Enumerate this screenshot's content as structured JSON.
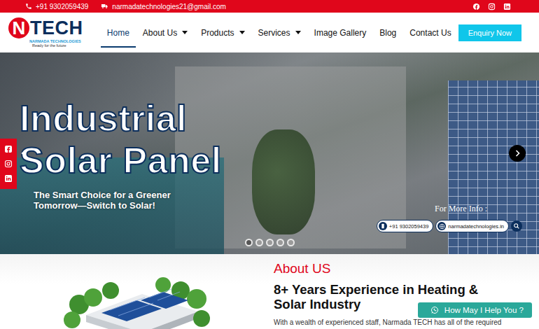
{
  "topbar": {
    "phone": "+91 9302059439",
    "email": "narmadatechnologies21@gmail.com"
  },
  "logo": {
    "letter": "N",
    "word": "TECH",
    "company": "NARMADA TECHNOLOGIES",
    "tagline": "Ready for the future"
  },
  "nav": {
    "items": [
      {
        "label": "Home",
        "selected": true,
        "dropdown": false
      },
      {
        "label": "About Us",
        "selected": false,
        "dropdown": true
      },
      {
        "label": "Products",
        "selected": false,
        "dropdown": true
      },
      {
        "label": "Services",
        "selected": false,
        "dropdown": true
      },
      {
        "label": "Image Gallery",
        "selected": false,
        "dropdown": false
      },
      {
        "label": "Blog",
        "selected": false,
        "dropdown": false
      },
      {
        "label": "Contact Us",
        "selected": false,
        "dropdown": false
      }
    ],
    "button": "Enquiry Now"
  },
  "hero": {
    "title_lines": [
      "Industrial",
      "Solar Panel"
    ],
    "subtitle_lines": [
      "The Smart Choice for a Greener",
      "Tomorrow—Switch to Solar!"
    ],
    "info_label": "For More Info :",
    "info_phone": "+91 9302059439",
    "info_site": "narmadatechnologies.in",
    "dots": [
      {
        "selected": true
      },
      {
        "selected": false
      },
      {
        "selected": false
      },
      {
        "selected": false
      },
      {
        "selected": false
      }
    ]
  },
  "about": {
    "label": "About US",
    "heading_lines": [
      "8+ Years Experience in Heating &",
      "Solar Industry"
    ],
    "text": "With a wealth of experienced staff, Narmada TECH has all of the required"
  },
  "chat": {
    "label": "How May I Help You ?"
  }
}
